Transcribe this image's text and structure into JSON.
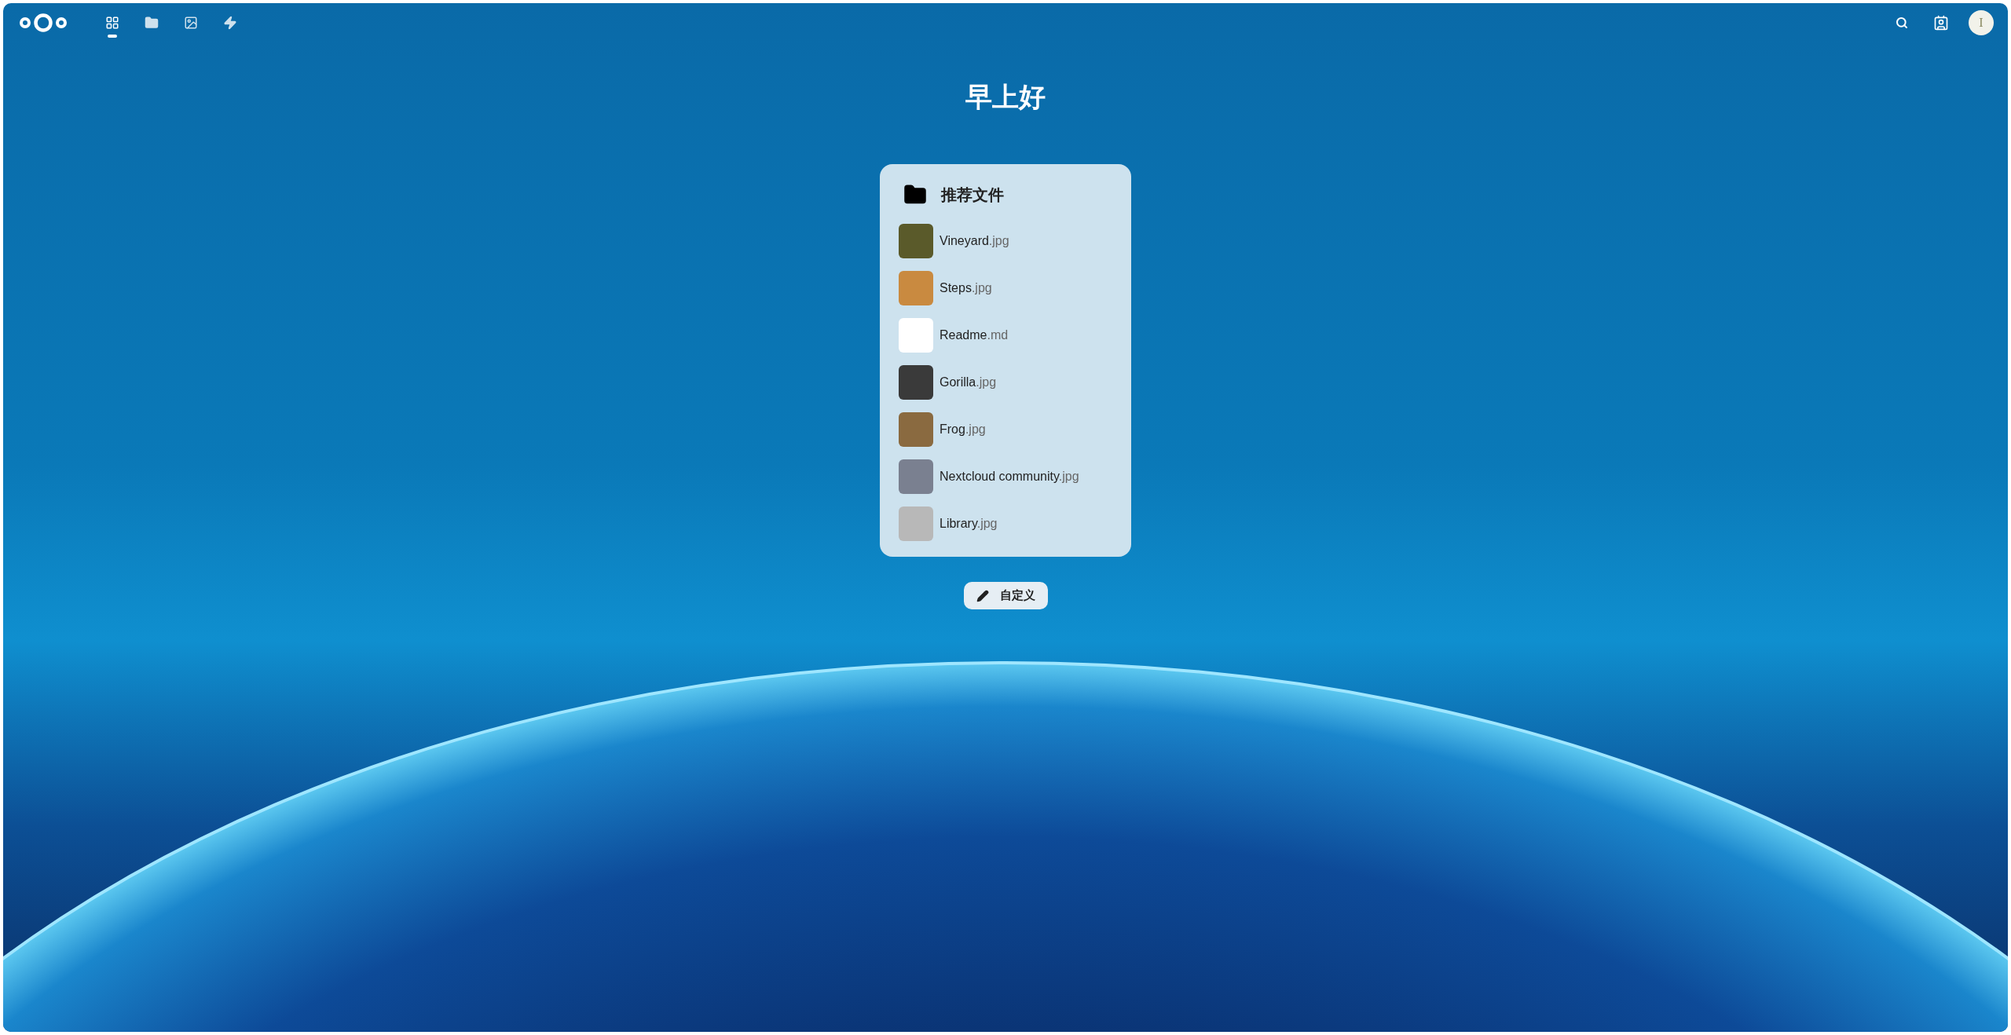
{
  "header": {
    "apps": [
      {
        "kind": "dashboard",
        "selected": true
      },
      {
        "kind": "files",
        "selected": false
      },
      {
        "kind": "photos",
        "selected": false
      },
      {
        "kind": "activity",
        "selected": false
      }
    ],
    "avatar": "I"
  },
  "greeting": "早上好",
  "widget": {
    "title": "推荐文件",
    "files": [
      {
        "name": "Vineyard",
        "ext": ".jpg",
        "kind": "image"
      },
      {
        "name": "Steps",
        "ext": ".jpg",
        "kind": "image"
      },
      {
        "name": "Readme",
        "ext": ".md",
        "kind": "document"
      },
      {
        "name": "Gorilla",
        "ext": ".jpg",
        "kind": "image"
      },
      {
        "name": "Frog",
        "ext": ".jpg",
        "kind": "image"
      },
      {
        "name": "Nextcloud community",
        "ext": ".jpg",
        "kind": "image"
      },
      {
        "name": "Library",
        "ext": ".jpg",
        "kind": "image"
      }
    ]
  },
  "customize_button": "自定义"
}
